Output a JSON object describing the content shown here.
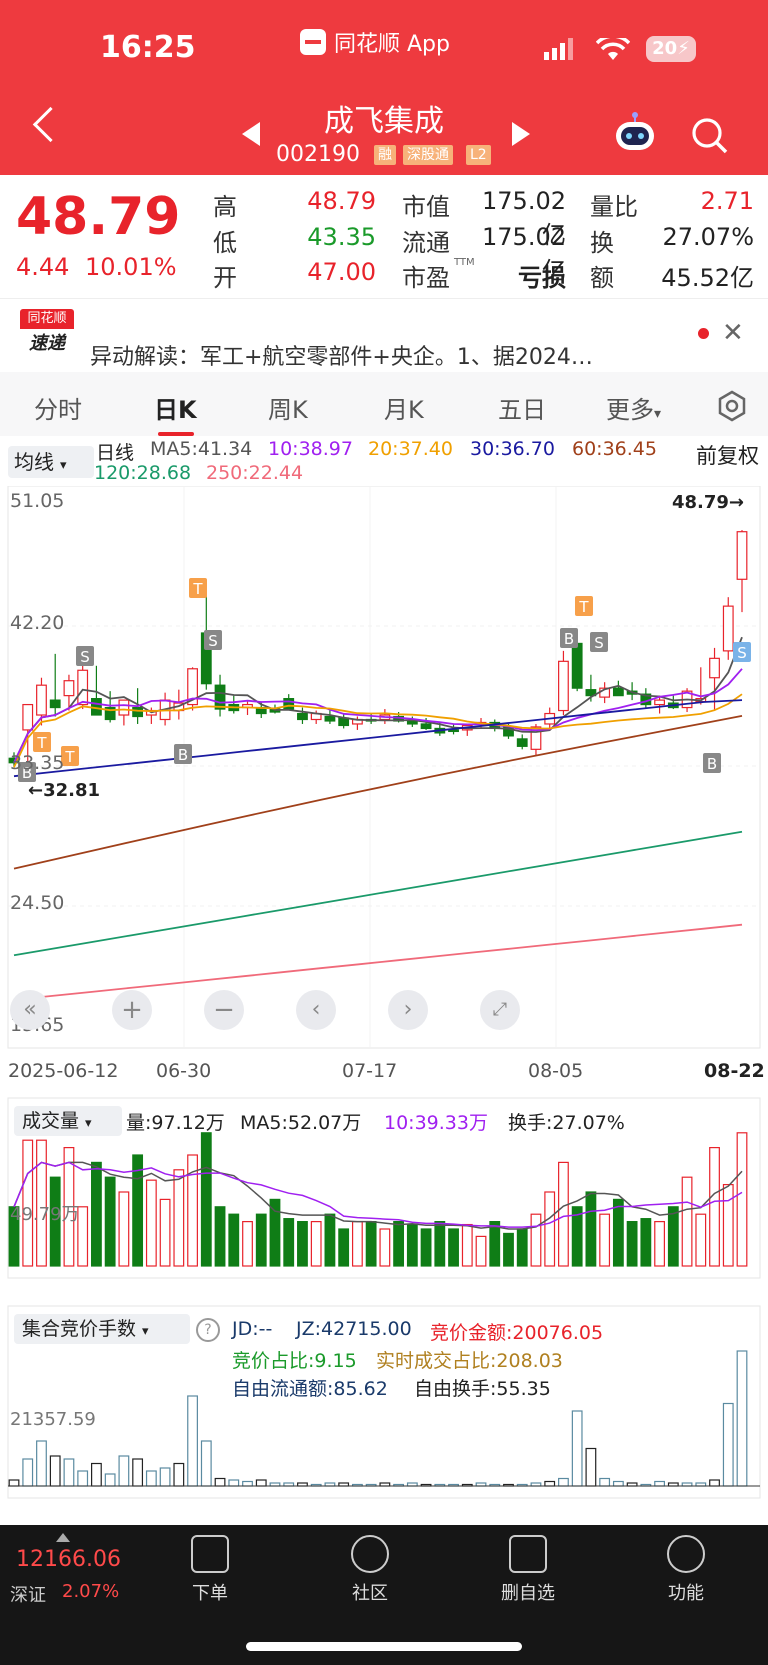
{
  "status_bar": {
    "time": "16:25",
    "app_name": "同花顺 App",
    "battery": "20"
  },
  "header": {
    "stock_name": "成飞集成",
    "stock_code": "002190",
    "tags": [
      "融",
      "深股通",
      "L2"
    ]
  },
  "quote": {
    "price": "48.79",
    "change": "4.44",
    "change_pct": "10.01%",
    "labels": {
      "high": "高",
      "low": "低",
      "open": "开",
      "mcap": "市值",
      "float": "流通",
      "pe": "市盈",
      "pe_sup": "TTM",
      "vol_ratio": "量比",
      "turnover": "换",
      "amount": "额"
    },
    "values": {
      "high": "48.79",
      "low": "43.35",
      "open": "47.00",
      "mcap": "175.02亿",
      "float": "175.02亿",
      "pe": "亏损",
      "vol_ratio": "2.71",
      "turnover": "27.07%",
      "amount": "45.52亿"
    }
  },
  "news": {
    "logo_top": "同花顺",
    "logo_bottom": "速递",
    "text": "异动解读：军工+航空零部件+央企。1、据2024…"
  },
  "tabs": [
    "分时",
    "日K",
    "周K",
    "月K",
    "五日",
    "更多"
  ],
  "active_tab": "日K",
  "kline_header": {
    "indicator": "均线",
    "period": "日线",
    "adjust": "前复权",
    "ma": [
      {
        "label": "MA5:41.34",
        "color": "#555555"
      },
      {
        "label": "10:38.97",
        "color": "#a020f0"
      },
      {
        "label": "20:37.40",
        "color": "#f0a000"
      },
      {
        "label": "30:36.70",
        "color": "#1a1aa0"
      },
      {
        "label": "60:36.45",
        "color": "#a0401a"
      },
      {
        "label": "120:28.68",
        "color": "#1a9a6a"
      },
      {
        "label": "250:22.44",
        "color": "#f06a7a"
      }
    ]
  },
  "kline": {
    "y_labels": [
      "51.05",
      "42.20",
      "33.35",
      "24.50",
      "15.65"
    ],
    "date_labels": [
      "2025-06-12",
      "06-30",
      "07-17",
      "08-05",
      "08-22"
    ],
    "last_price_tag": "48.79→",
    "low_price_tag": "←32.81",
    "markers": [
      "B",
      "T",
      "S"
    ]
  },
  "volume_panel": {
    "title": "成交量",
    "vol": "量:97.12万",
    "ma5": "MA5:52.07万",
    "ma10": "10:39.33万",
    "turnover": "换手:27.07%",
    "y_label": "49.79万"
  },
  "auction_panel": {
    "title": "集合竞价手数",
    "jd": "JD:--",
    "jz": "JZ:42715.00",
    "amount": "竞价金额:20076.05",
    "ratio": "竞价占比:9.15",
    "deal_ratio": "实时成交占比:208.03",
    "free_float": "自由流通额:85.62",
    "free_turnover": "自由换手:55.35",
    "y_label": "21357.59"
  },
  "bottom_nav": {
    "index_value": "12166.06",
    "index_name": "深证",
    "index_change": "2.07%",
    "items": [
      "下单",
      "社区",
      "删自选",
      "功能"
    ]
  },
  "chart_data": {
    "type": "candlestick",
    "title": "",
    "ylim": [
      15.65,
      51.05
    ],
    "x": [
      "2025-06-12",
      "06-30",
      "07-17",
      "08-05",
      "08-22"
    ],
    "last_close": 48.79,
    "ma": {
      "MA5": 41.34,
      "MA10": 38.97,
      "MA20": 37.4,
      "MA30": 36.7,
      "MA60": 36.45,
      "MA120": 28.68,
      "MA250": 22.44
    }
  }
}
